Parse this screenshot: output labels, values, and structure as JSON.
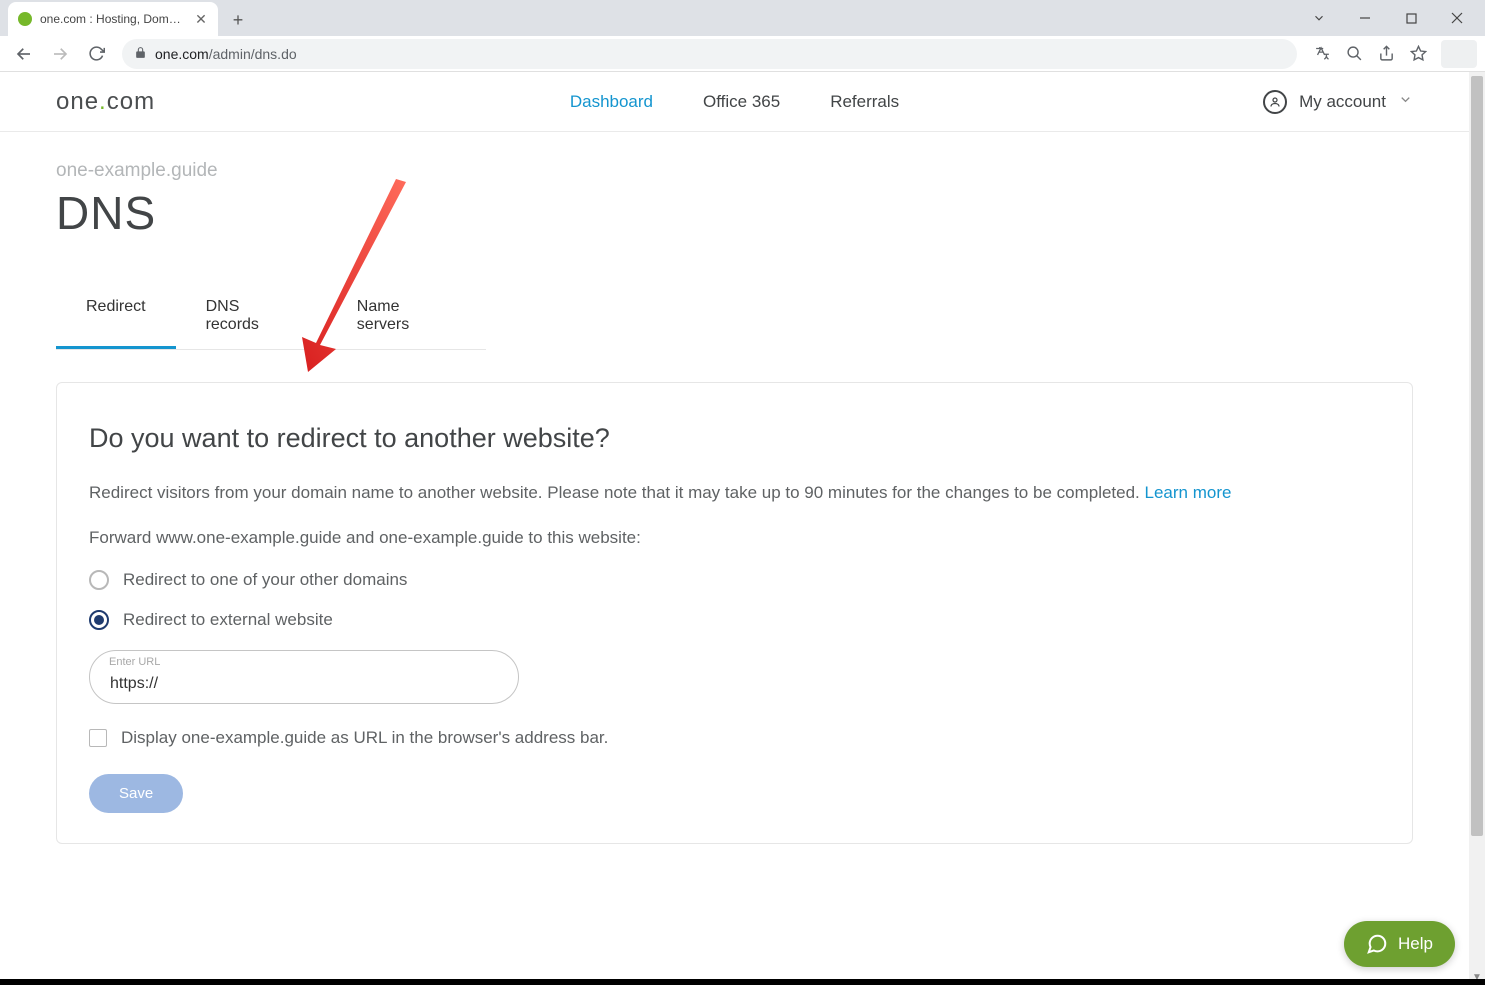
{
  "browser": {
    "tab_title": "one.com : Hosting, Domain, Ema",
    "url_domain": "one.com",
    "url_path": "/admin/dns.do"
  },
  "header": {
    "logo_text_one": "one",
    "logo_text_com": "com",
    "nav": {
      "dashboard": "Dashboard",
      "office365": "Office 365",
      "referrals": "Referrals"
    },
    "account_label": "My account"
  },
  "page": {
    "domain": "one-example.guide",
    "title": "DNS",
    "tabs": {
      "redirect": "Redirect",
      "dns_records": "DNS records",
      "name_servers": "Name servers"
    }
  },
  "panel": {
    "title": "Do you want to redirect to another website?",
    "desc_text": "Redirect visitors from your domain name to another website. Please note that it may take up to 90 minutes for the changes to be completed. ",
    "learn_more": "Learn more",
    "forward_text": "Forward www.one-example.guide and one-example.guide to this website:",
    "radio_other_domains": "Redirect to one of your other domains",
    "radio_external": "Redirect to external website",
    "url_label": "Enter URL",
    "url_value": "https://",
    "display_url_text": "Display one-example.guide as URL in the browser's address bar.",
    "save_label": "Save"
  },
  "help": {
    "label": "Help"
  }
}
